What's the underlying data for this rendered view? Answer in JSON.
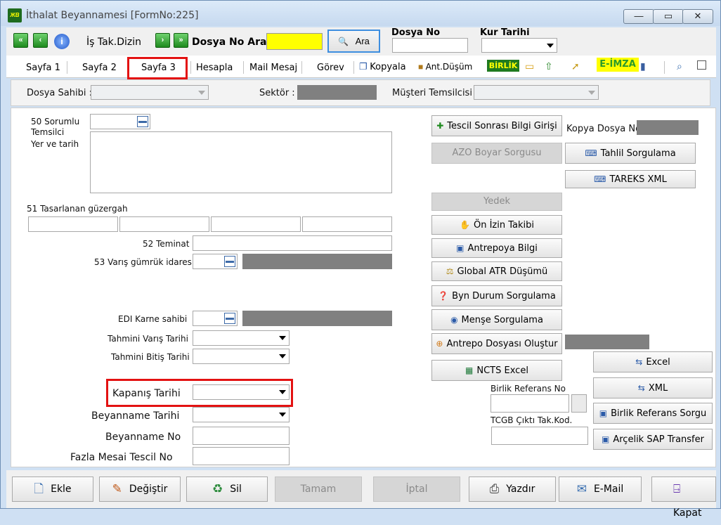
{
  "window": {
    "title": "İthalat Beyannamesi [FormNo:225]",
    "app_icon_text": "ЖВ",
    "minimize_glyph": "—",
    "maximize_glyph": "▭",
    "close_glyph": "✕"
  },
  "toolbar": {
    "first_glyph": "«",
    "prev_glyph": "‹",
    "next_glyph": "›",
    "last_glyph": "»",
    "info_glyph": "i",
    "is_takip_label": "İş Tak.Dizin",
    "dosya_no_ara_label": "Dosya No Ara",
    "ara_label": "Ara",
    "search_glyph": "🔍",
    "dosya_no_label": "Dosya No",
    "kur_tarihi_label": "Kur Tarihi"
  },
  "tabs": [
    {
      "label": "Sayfa 1"
    },
    {
      "label": "Sayfa 2"
    },
    {
      "label": "Sayfa 3"
    },
    {
      "label": "Hesapla"
    },
    {
      "label": "Mail Mesaj"
    },
    {
      "label": "Görev"
    }
  ],
  "tab_tools": {
    "kopyala_label": "Kopyala",
    "ant_dusum_label": "Ant.Düşüm",
    "birlik_label": "BİRLİK",
    "eimza_label": "E-İMZA"
  },
  "header": {
    "dosya_sahibi_label": "Dosya Sahibi :",
    "sektor_label": "Sektör :",
    "musteri_temsilcisi_label": "Müşteri Temsilcisi :"
  },
  "form": {
    "sorumlu_label": "50 Sorumlu",
    "temsilci_label": "Temsilci",
    "yer_tarih_label": "Yer ve tarih",
    "guzergah_label": "51 Tasarlanan güzergah",
    "teminat_label": "52 Teminat",
    "varis_gumruk_label": "53 Varış gümrük idaresi",
    "edi_karne_label": "EDI Karne sahibi",
    "tahmini_varis_label": "Tahmini Varış Tarihi",
    "tahmini_bitis_label": "Tahmini Bitiş Tarihi",
    "kapanis_label": "Kapanış Tarihi",
    "beyanname_tarihi_label": "Beyanname Tarihi",
    "beyanname_no_label": "Beyanname No",
    "fazla_mesai_label": "Fazla Mesai Tescil No"
  },
  "right_buttons": {
    "tescil_sonrasi": "Tescil Sonrası Bilgi Girişi",
    "kopya_dosya_no_label": "Kopya Dosya No",
    "azo_boyar": "AZO Boyar Sorgusu",
    "tahlil": "Tahlil Sorgulama",
    "tareks": "TAREKS XML",
    "yedek": "Yedek",
    "on_izin": "Ön İzin Takibi",
    "antrepoya_bilgi": "Antrepoya Bilgi",
    "global_atr": "Global ATR Düşümü",
    "byn_durum": "Byn Durum Sorgulama",
    "mense": "Menşe Sorgulama",
    "antrepo_dosyasi": "Antrepo Dosyası Oluştur",
    "ncts_excel": "NCTS Excel",
    "excel": "Excel",
    "xml": "XML",
    "birlik_referans_no_label": "Birlik Referans No",
    "birlik_referans_sorgu": "Birlik Referans Sorgu",
    "tcgb_cikti_label": "TCGB Çıktı Tak.Kod.",
    "arcelik_sap": "Arçelik SAP Transfer"
  },
  "bottom_bar": {
    "ekle": "Ekle",
    "degistir": "Değiştir",
    "sil": "Sil",
    "tamam": "Tamam",
    "iptal": "İptal",
    "yazdir": "Yazdır",
    "email": "E-Mail",
    "kapat": "Kapat"
  },
  "colors": {
    "highlight_red": "#e31212",
    "yellow_input": "#ffff00",
    "window_bg": "#cfe0f3"
  }
}
